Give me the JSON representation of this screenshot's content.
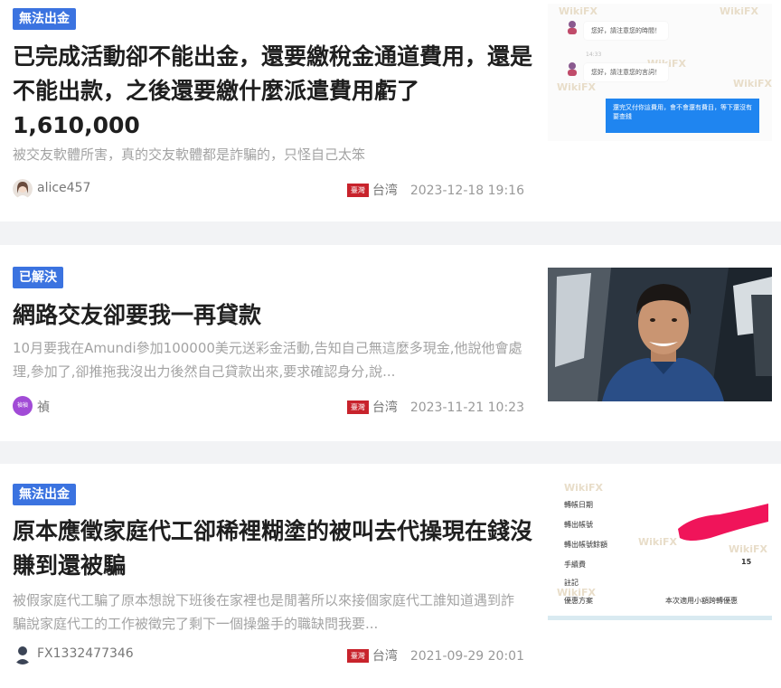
{
  "posts": [
    {
      "tag": "無法出金",
      "title": "已完成活動卻不能出金，還要繳稅金通道費用，還是不能出款，之後還要繳什麼派遣費用虧了1,610,000",
      "summary": "被交友軟體所害，真的交友軟體都是詐騙的，只怪自己太笨",
      "author": "alice457",
      "flag": "臺灣",
      "region": "台湾",
      "date": "2023-12-18 19:16",
      "thumb": {
        "greeting_1": "您好，請注意您的時間！",
        "greeting_2": "您好，請注意您的言詞！",
        "time_1": "14:33",
        "blue_text": "還完又付你這費用，會不會還有費目，等下還沒有要查錢",
        "watermark": "WikiFX"
      }
    },
    {
      "tag": "已解決",
      "title": "網路交友卻要我一再貸款",
      "summary": "10月要我在Amundi參加100000美元送彩金活動,告知自己無這麼多現金,他說他會處理,參加了,卻推拖我沒出力後然自己貸款出來,要求確認身分,說...",
      "author": "禎",
      "avatar_text": "禎禎",
      "flag": "臺灣",
      "region": "台湾",
      "date": "2023-11-21 10:23"
    },
    {
      "tag": "無法出金",
      "title": "原本應徵家庭代工卻稀裡糊塗的被叫去代操現在錢沒賺到還被騙",
      "summary": "被假家庭代工騙了原本想說下班後在家裡也是閒著所以來接個家庭代工誰知道遇到詐騙說家庭代工的工作被徵完了剩下一個操盤手的職缺問我要...",
      "author": "FX1332477346",
      "flag": "臺灣",
      "region": "台湾",
      "date": "2021-09-29 20:01",
      "thumb": {
        "rows": [
          "轉帳日期",
          "轉出帳號",
          "轉出帳號餘額",
          "手續費",
          "註記",
          "優惠方案"
        ],
        "fee_value": "15",
        "promo_value": "本次適用小額跨轉優惠",
        "watermark": "WikiFX"
      }
    }
  ],
  "colors": {
    "tag_blue": "#3b73e0",
    "flag_red": "#c8232c",
    "chat_blue": "#1f85f0",
    "redaction": "#f0145a"
  }
}
